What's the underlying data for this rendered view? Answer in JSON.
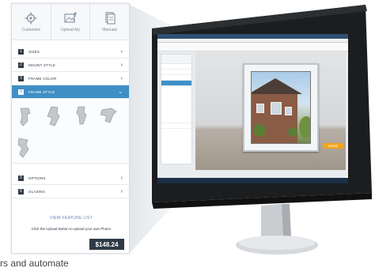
{
  "configurator": {
    "top_tabs": [
      {
        "label": "Customize",
        "icon": "gear-icon"
      },
      {
        "label": "Upload My",
        "icon": "upload-image-icon"
      },
      {
        "label": "Manuals",
        "icon": "document-icon"
      }
    ],
    "menu": [
      {
        "number": "1",
        "label": "SIZES"
      },
      {
        "number": "2",
        "label": "MOUNT STYLE"
      },
      {
        "number": "3",
        "label": "FRAME COLOR"
      },
      {
        "number": "4",
        "label": "FRAME STYLE",
        "active": true
      }
    ],
    "profile_options": [
      "frame-profile-1",
      "frame-profile-2",
      "frame-profile-3",
      "frame-profile-4",
      "frame-profile-5"
    ],
    "menu_lower": [
      {
        "number": "5",
        "label": "OPTIONS"
      },
      {
        "number": "6",
        "label": "GLAZING"
      }
    ],
    "feature_link": "VIEW FEATURE LIST",
    "upload_note": "Click the Upload Button to upload your own Photo!",
    "price": "$148.24"
  },
  "monitor": {
    "order_button": "ORDER"
  },
  "caption": "rs and automate",
  "colors": {
    "accent": "#3f8fc6",
    "dark": "#2f3a47",
    "order": "#f2a51c"
  }
}
